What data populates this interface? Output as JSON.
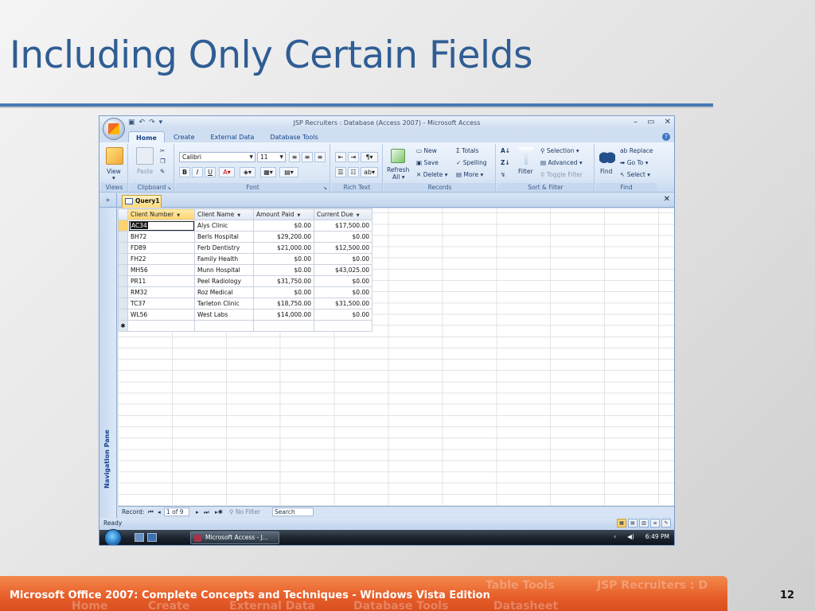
{
  "slide": {
    "title": "Including Only Certain Fields",
    "footer": "Microsoft Office 2007: Complete Concepts and Techniques - Windows Vista Edition",
    "page_number": "12",
    "footer_ghost": [
      "Table Tools",
      "JSP Recruiters : D",
      "Home",
      "Create",
      "External Data",
      "Database Tools",
      "Datasheet"
    ]
  },
  "window": {
    "title": "JSP Recruiters : Database (Access 2007) - Microsoft Access",
    "controls": [
      "–",
      "▭",
      "✕"
    ]
  },
  "ribbon": {
    "tabs": [
      "Home",
      "Create",
      "External Data",
      "Database Tools"
    ],
    "views": {
      "view_label": "View",
      "group_label": "Views"
    },
    "clipboard": {
      "paste_label": "Paste",
      "group_label": "Clipboard"
    },
    "font": {
      "font_name": "Calibri",
      "font_size": "11",
      "group_label": "Font"
    },
    "rich_text": {
      "group_label": "Rich Text"
    },
    "records": {
      "refresh_label": "Refresh",
      "refresh_sub": "All",
      "new_label": "New",
      "save_label": "Save",
      "delete_label": "Delete",
      "totals_label": "Totals",
      "spelling_label": "Spelling",
      "more_label": "More",
      "group_label": "Records"
    },
    "sort_filter": {
      "filter_label": "Filter",
      "selection_label": "Selection",
      "advanced_label": "Advanced",
      "toggle_filter_label": "Toggle Filter",
      "group_label": "Sort & Filter"
    },
    "find": {
      "find_label": "Find",
      "replace_label": "Replace",
      "goto_label": "Go To",
      "select_label": "Select",
      "group_label": "Find"
    }
  },
  "document": {
    "tab_label": "Query1",
    "nav_pane_label": "Navigation Pane",
    "shutter_glyph": "»",
    "close_glyph": "✕"
  },
  "datasheet": {
    "columns": [
      "Client Number",
      "Client Name",
      "Amount Paid",
      "Current Due"
    ],
    "rows": [
      [
        "AC34",
        "Alys Clinic",
        "$0.00",
        "$17,500.00"
      ],
      [
        "BH72",
        "Berls Hospital",
        "$29,200.00",
        "$0.00"
      ],
      [
        "FD89",
        "Ferb Dentistry",
        "$21,000.00",
        "$12,500.00"
      ],
      [
        "FH22",
        "Family Health",
        "$0.00",
        "$0.00"
      ],
      [
        "MH56",
        "Munn Hospital",
        "$0.00",
        "$43,025.00"
      ],
      [
        "PR11",
        "Peel Radiology",
        "$31,750.00",
        "$0.00"
      ],
      [
        "RM32",
        "Roz Medical",
        "$0.00",
        "$0.00"
      ],
      [
        "TC37",
        "Tarleton Clinic",
        "$18,750.00",
        "$31,500.00"
      ],
      [
        "WL56",
        "West Labs",
        "$14,000.00",
        "$0.00"
      ]
    ],
    "new_row_glyph": "✱"
  },
  "record_nav": {
    "record_label": "Record:",
    "position": "1 of 9",
    "filter_label": "No Filter",
    "search_label": "Search"
  },
  "status": {
    "text": "Ready"
  },
  "taskbar": {
    "task_label": "Microsoft Access - J...",
    "time": "6:49 PM"
  }
}
